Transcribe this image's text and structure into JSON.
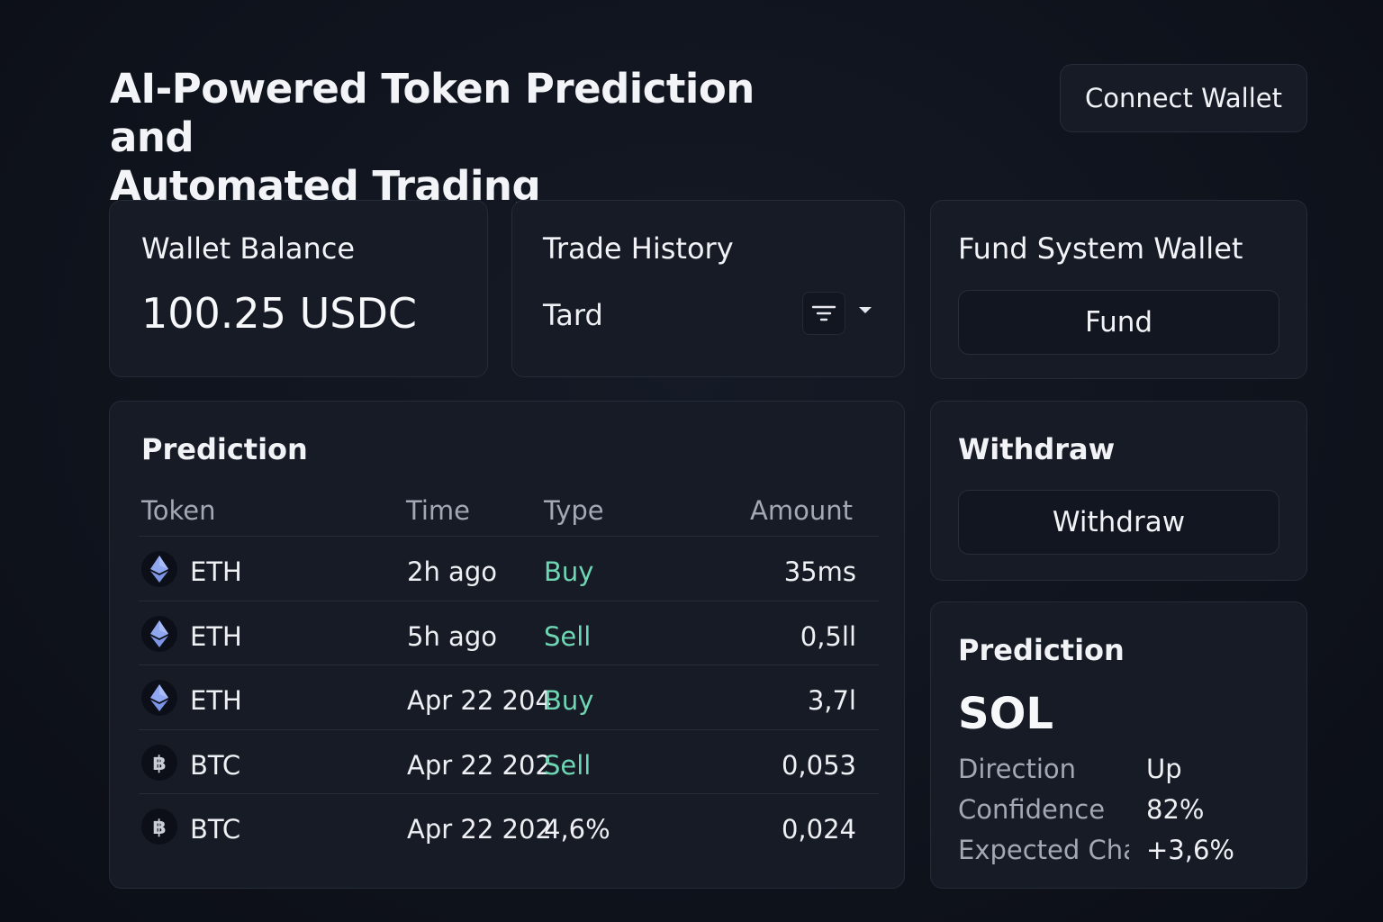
{
  "header": {
    "title_line1": "AI-Powered Token Prediction and",
    "title_line2": "Automated Trading",
    "connect_label": "Connect Wallet"
  },
  "wallet": {
    "title": "Wallet Balance",
    "balance": "100.25 USDC"
  },
  "history": {
    "title": "Trade History",
    "selected": "Tard",
    "filter_icon": "filter-icon",
    "dropdown_icon": "chevron-down-icon"
  },
  "fund": {
    "title": "Fund System Wallet",
    "button": "Fund"
  },
  "withdraw": {
    "title": "Withdraw",
    "button": "Withdraw"
  },
  "prediction_table": {
    "title": "Prediction",
    "columns": [
      "Token",
      "Time",
      "Type",
      "Amount"
    ],
    "rows": [
      {
        "icon": "eth-icon",
        "token": "ETH",
        "time": "2h ago",
        "type": "Buy",
        "amount": "35ms"
      },
      {
        "icon": "eth-icon",
        "token": "ETH",
        "time": "5h ago",
        "type": "Sell",
        "amount": "0,5ll"
      },
      {
        "icon": "eth-icon",
        "token": "ETH",
        "time": "Apr 22 204",
        "type": "Buy",
        "amount": "3,7l"
      },
      {
        "icon": "btc-icon",
        "token": "BTC",
        "time": "Apr 22 202",
        "type": "Sell",
        "amount": "0,053"
      },
      {
        "icon": "btc-icon",
        "token": "BTC",
        "time": "Apr 22 202",
        "type": "4,6%",
        "amount": "0,024"
      }
    ]
  },
  "prediction_card": {
    "title": "Prediction",
    "token": "SOL",
    "direction_label": "Direction",
    "direction_value": "Up",
    "confidence_label": "Confidence",
    "confidence_value": "82%",
    "change_label": "Expected Cha",
    "change_value": "+3,6%"
  },
  "colors": {
    "background": "#0f131d",
    "card": "#161b26",
    "accent_green": "#6fd6b4",
    "eth": "#8fa6f0"
  }
}
